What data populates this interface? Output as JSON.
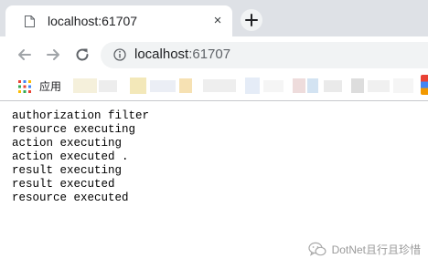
{
  "tab": {
    "title": "localhost:61707",
    "close_glyph": "×"
  },
  "toolbar": {
    "url_host": "localhost",
    "url_port": ":61707"
  },
  "bookmarks": {
    "apps_label": "应用"
  },
  "page": {
    "lines": [
      "authorization filter",
      "resource executing",
      "action executing",
      "action executed .",
      "result executing",
      "result executed",
      "resource executed"
    ]
  },
  "watermark": {
    "text": "DotNet且行且珍惜"
  },
  "colors": {
    "tabstrip_bg": "#dee1e6",
    "omnibox_bg": "#f1f3f4",
    "icon_gray": "#5f6368",
    "disabled_gray": "#a0a4a8"
  }
}
